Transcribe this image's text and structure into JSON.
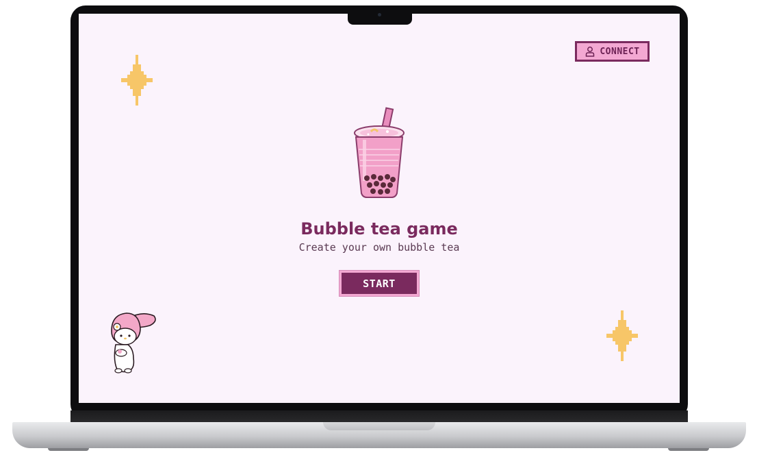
{
  "header": {
    "connect_label": "CONNECT"
  },
  "hero": {
    "title": "Bubble tea game",
    "subtitle": "Create your own bubble tea",
    "start_label": "START"
  },
  "colors": {
    "background": "#fbf3fc",
    "primary": "#7a2a5e",
    "accent": "#f3a8d2",
    "sparkle": "#f7c668"
  },
  "icons": {
    "connect": "user-icon",
    "hero": "bubble-tea-cup-icon",
    "decor": [
      "sparkle-icon",
      "sparkle-icon",
      "bunny-mascot-icon"
    ]
  }
}
